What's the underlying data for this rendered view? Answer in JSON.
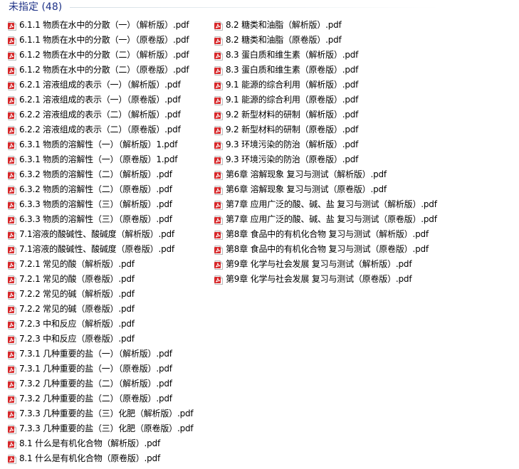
{
  "group": {
    "title": "未指定 (48)"
  },
  "colors": {
    "header_text": "#1e3287",
    "icon_red": "#d7282a"
  },
  "icon": "pdf-file-icon",
  "files": {
    "left": [
      "6.1.1 物质在水中的分散（一）（解析版）.pdf",
      "6.1.1 物质在水中的分散（一）（原卷版）.pdf",
      "6.1.2 物质在水中的分散（二）（解析版）.pdf",
      "6.1.2 物质在水中的分散（二）（原卷版）.pdf",
      "6.2.1 溶液组成的表示（一）（解析版）.pdf",
      "6.2.1 溶液组成的表示（一）（原卷版）.pdf",
      "6.2.2 溶液组成的表示（二）（解析版）.pdf",
      "6.2.2 溶液组成的表示（二）（原卷版）.pdf",
      "6.3.1 物质的溶解性（一）（解析版）1.pdf",
      "6.3.1 物质的溶解性（一）（原卷版）1.pdf",
      "6.3.2 物质的溶解性（二）（解析版）.pdf",
      "6.3.2 物质的溶解性（二）（原卷版）.pdf",
      "6.3.3 物质的溶解性（三）（解析版）.pdf",
      "6.3.3 物质的溶解性（三）（原卷版）.pdf",
      "7.1溶液的酸碱性、酸碱度（解析版）.pdf",
      "7.1溶液的酸碱性、酸碱度（原卷版）.pdf",
      "7.2.1  常见的酸（解析版）.pdf",
      "7.2.1  常见的酸（原卷版）.pdf",
      "7.2.2  常见的碱（解析版）.pdf",
      "7.2.2  常见的碱（原卷版）.pdf",
      "7.2.3  中和反应（解析版）.pdf",
      "7.2.3  中和反应（原卷版）.pdf",
      "7.3.1  几种重要的盐（一）（解析版）.pdf",
      "7.3.1  几种重要的盐（一）（原卷版）.pdf",
      "7.3.2  几种重要的盐（二）（解析版）.pdf",
      "7.3.2  几种重要的盐（二）（原卷版）.pdf",
      "7.3.3  几种重要的盐（三）化肥（解析版）.pdf",
      "7.3.3  几种重要的盐（三）化肥（原卷版）.pdf",
      "8.1 什么是有机化合物（解析版）.pdf",
      "8.1 什么是有机化合物（原卷版）.pdf"
    ],
    "right": [
      "8.2 糖类和油脂（解析版）.pdf",
      "8.2 糖类和油脂（原卷版）.pdf",
      "8.3 蛋白质和维生素（解析版）.pdf",
      "8.3 蛋白质和维生素（原卷版）.pdf",
      "9.1 能源的综合利用（解析版）.pdf",
      "9.1 能源的综合利用（原卷版）.pdf",
      "9.2 新型材料的研制（解析版）.pdf",
      "9.2 新型材料的研制（原卷版）.pdf",
      "9.3 环境污染的防治（解析版）.pdf",
      "9.3 环境污染的防治（原卷版）.pdf",
      "第6章 溶解现象 复习与测试（解析版）.pdf",
      "第6章 溶解现象 复习与测试（原卷版）.pdf",
      "第7章 应用广泛的酸、碱、盐 复习与测试（解析版）.pdf",
      "第7章 应用广泛的酸、碱、盐 复习与测试（原卷版）.pdf",
      "第8章  食品中的有机化合物 复习与测试（解析版）.pdf",
      "第8章  食品中的有机化合物 复习与测试（原卷版）.pdf",
      "第9章 化学与社会发展 复习与测试（解析版）.pdf",
      "第9章 化学与社会发展 复习与测试（原卷版）.pdf"
    ]
  }
}
